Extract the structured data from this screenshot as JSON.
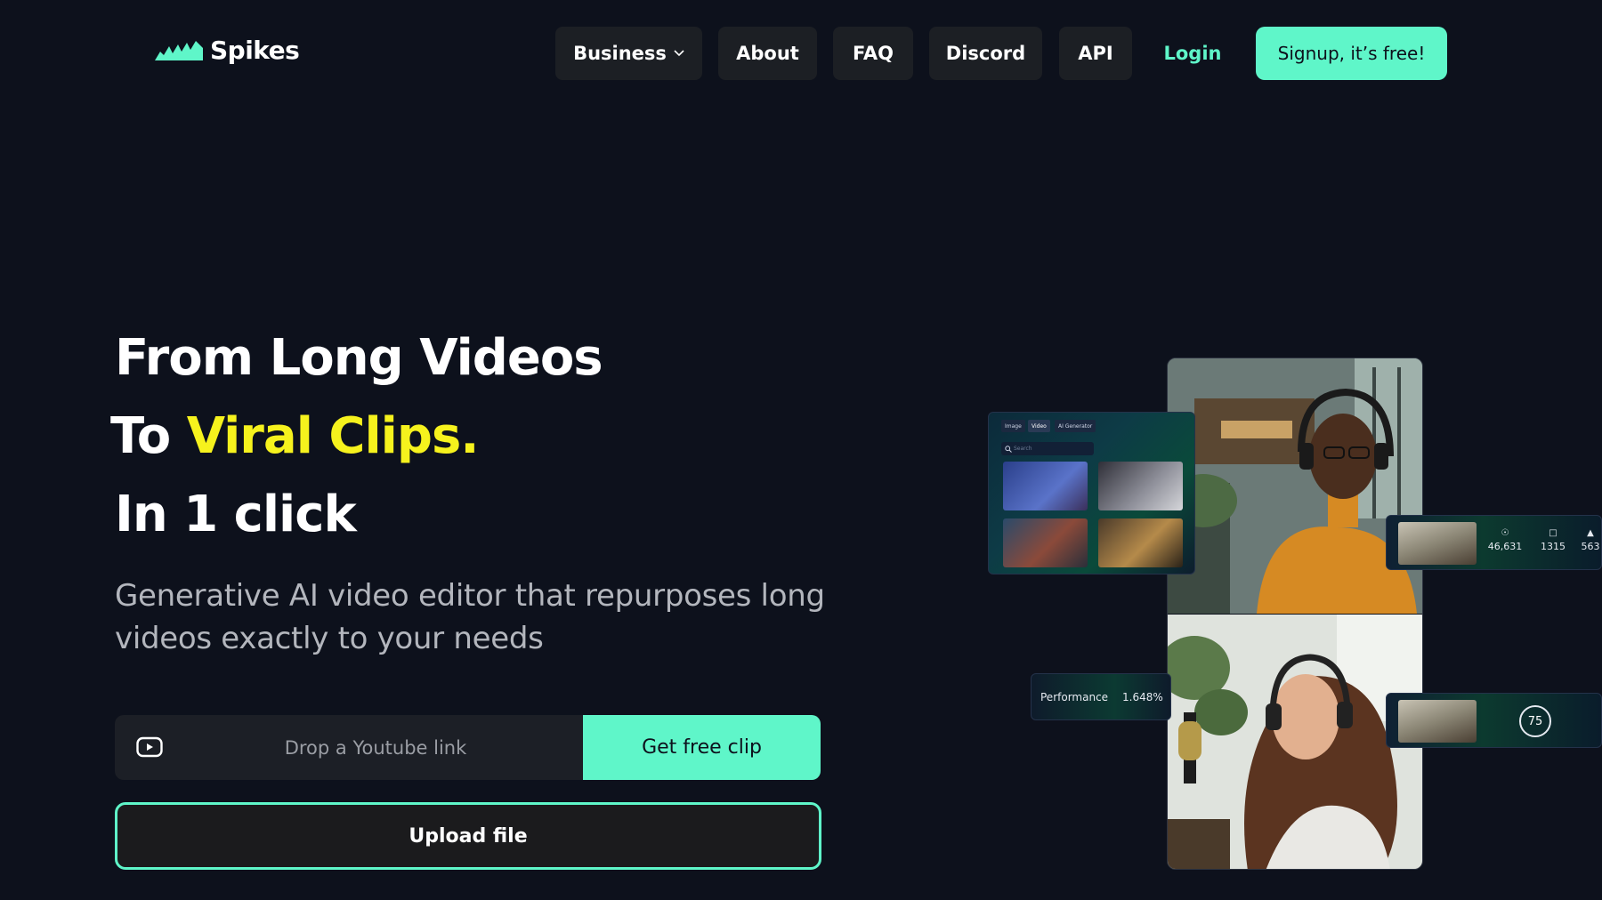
{
  "brand": {
    "name": "Spikes",
    "accent": "#5ff6c9",
    "highlight": "#f6f21d",
    "background": "#0d111c"
  },
  "nav": {
    "business": "Business",
    "about": "About",
    "faq": "FAQ",
    "discord": "Discord",
    "api": "API",
    "login": "Login",
    "signup": "Signup, it’s free!"
  },
  "hero": {
    "line1": "From Long Videos",
    "line2_prefix": "To ",
    "line2_highlight": "Viral Clips.",
    "line3": "In 1 click",
    "subtitle": "Generative AI video editor that repurposes long videos exactly to your needs"
  },
  "input": {
    "placeholder": "Drop a Youtube link",
    "cta": "Get free clip",
    "upload": "Upload file"
  },
  "illustration": {
    "tabs": [
      "Image",
      "Video",
      "AI Generator"
    ],
    "search_placeholder": "Search",
    "stats": {
      "views": "46,631",
      "comments": "1315",
      "likes": "563"
    },
    "performance_label": "Performance",
    "performance_value": "1.648%",
    "score": "75"
  }
}
